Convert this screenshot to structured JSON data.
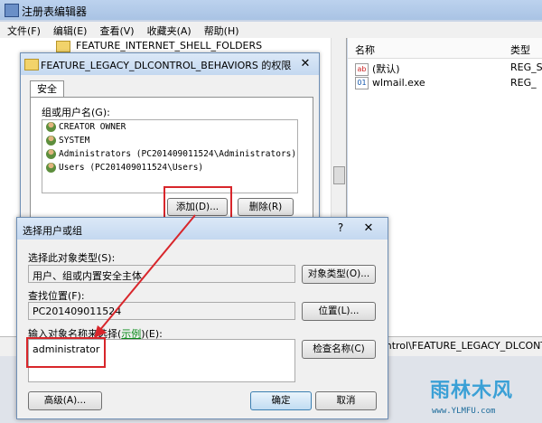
{
  "regedit": {
    "title": "注册表编辑器",
    "menu": [
      "文件(F)",
      "编辑(E)",
      "查看(V)",
      "收藏夹(A)",
      "帮助(H)"
    ],
    "tree_item": "FEATURE_INTERNET_SHELL_FOLDERS",
    "list_columns": {
      "name": "名称",
      "type": "类型"
    },
    "list_rows": [
      {
        "name": "(默认)",
        "type": "REG_S"
      },
      {
        "name": "wlmail.exe",
        "type": "REG_"
      }
    ],
    "status_path": "ontrol\\FEATURE_LEGACY_DLCONT"
  },
  "permissions_dialog": {
    "title": "FEATURE_LEGACY_DLCONTROL_BEHAVIORS 的权限",
    "close": "✕",
    "tab": "安全",
    "group_label": "组或用户名(G):",
    "users": [
      "CREATOR OWNER",
      "SYSTEM",
      "Administrators (PC201409011524\\Administrators)",
      "Users (PC201409011524\\Users)"
    ],
    "add_button": "添加(D)...",
    "remove_button": "删除(R)"
  },
  "select_dialog": {
    "title": "选择用户或组",
    "help": "?",
    "close": "✕",
    "object_type_label": "选择此对象类型(S):",
    "object_type_value": "用户、组或内置安全主体",
    "object_type_button": "对象类型(O)...",
    "location_label": "查找位置(F):",
    "location_value": "PC201409011524",
    "location_button": "位置(L)...",
    "names_label_pre": "输入对象名称来选择(",
    "names_label_link": "示例",
    "names_label_post": ")(E):",
    "names_value": "administrator",
    "check_names_button": "检查名称(C)",
    "advanced_button": "高级(A)...",
    "ok_button": "确定",
    "cancel_button": "取消"
  },
  "watermark": {
    "main": "雨林木风",
    "url": "www.YLMFU.com"
  },
  "colors": {
    "highlight": "#d8262b",
    "link": "#0a8a1a"
  }
}
